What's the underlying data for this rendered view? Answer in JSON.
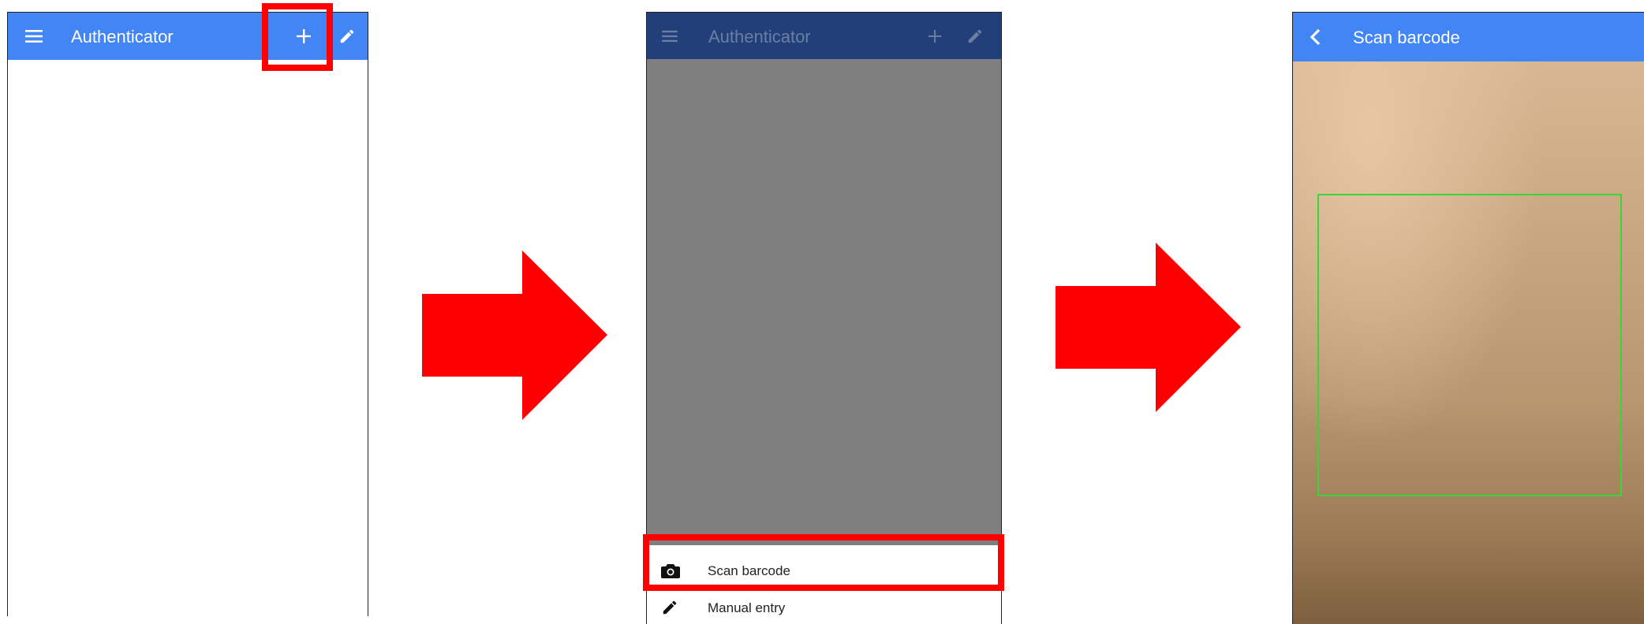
{
  "colors": {
    "appbar_blue": "#4285f4",
    "appbar_dimmed": "#223f7a",
    "overlay_gray": "#7f7f7f",
    "highlight_red": "#ff0000",
    "scan_frame_green": "#39d639"
  },
  "screen1": {
    "app_title": "Authenticator",
    "icons": [
      "menu-icon",
      "add-icon",
      "edit-icon"
    ]
  },
  "screen2": {
    "app_title": "Authenticator",
    "sheet": {
      "scan_label": "Scan barcode",
      "manual_label": "Manual entry"
    }
  },
  "screen3": {
    "title": "Scan barcode",
    "icons": [
      "back-icon"
    ]
  }
}
